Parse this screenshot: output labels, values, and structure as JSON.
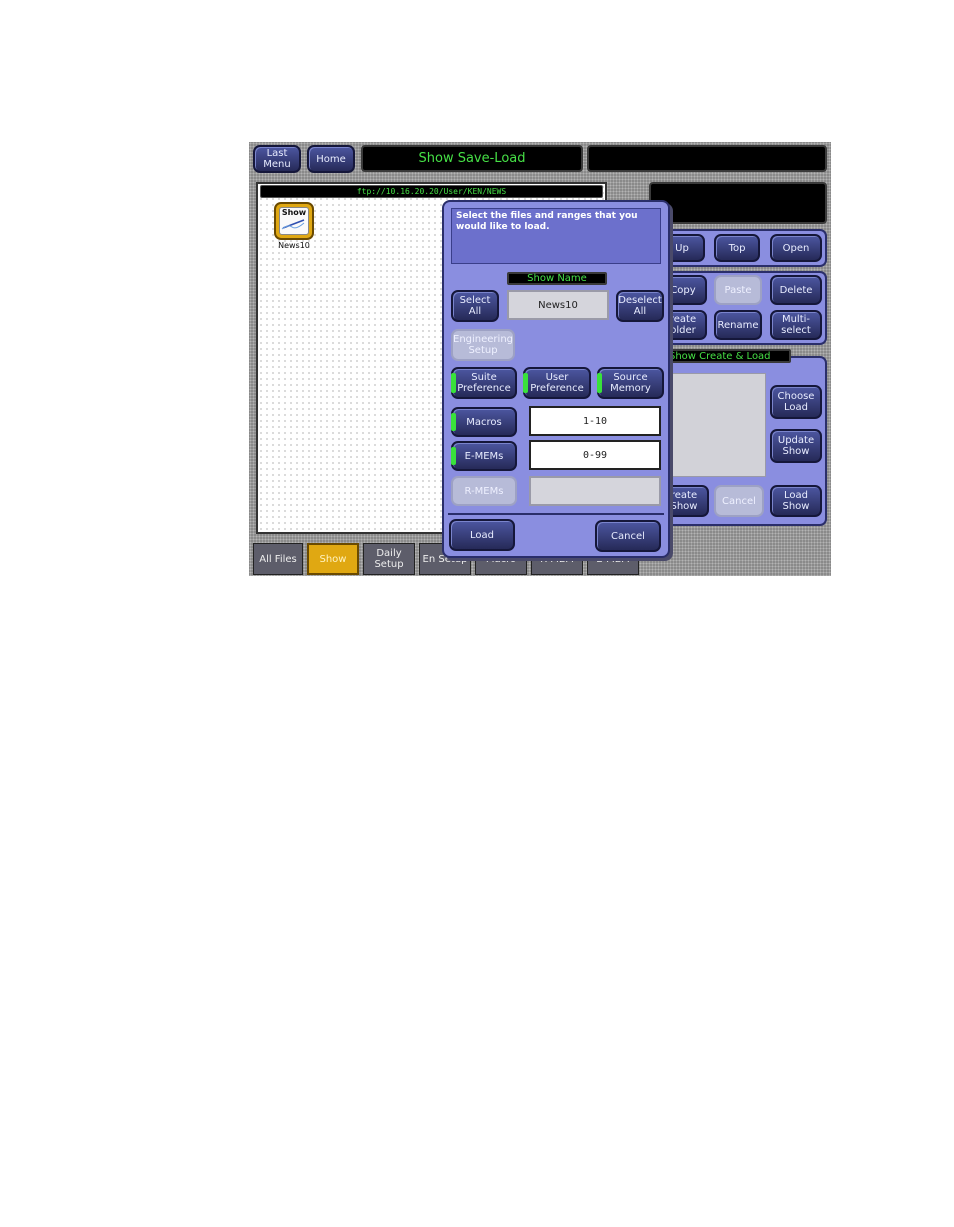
{
  "header": {
    "last_menu": "Last Menu",
    "home": "Home",
    "title": "Show Save-Load"
  },
  "browser": {
    "path": "ftp://10.16.20.20/User/KEN/NEWS",
    "file_icon_label": "Show",
    "file_name": "News10"
  },
  "nav_buttons": [
    "Up",
    "Top",
    "Open"
  ],
  "edit_buttons": [
    "Copy",
    "Paste",
    "Delete",
    "reate older",
    "Rename",
    "Multi-select"
  ],
  "show_panel": {
    "title": "Show Create & Load",
    "choose_load": "Choose Load",
    "update_show": "Update Show",
    "create_show": "reate Show",
    "cancel": "Cancel",
    "load_show": "Load Show"
  },
  "tabs": [
    "All Files",
    "Show",
    "Daily Setup",
    "En Setup",
    "Macro",
    "R-MEM",
    "E-MEM"
  ],
  "dialog": {
    "message": "Select the files and ranges that you would like to load.",
    "show_name_label": "Show Name",
    "show_name_value": "News10",
    "select_all": "Select All",
    "deselect_all": "Deselect All",
    "engineering_setup": "Engineering Setup",
    "suite_preference": "Suite Preference",
    "user_preference": "User Preference",
    "source_memory": "Source Memory",
    "macros": "Macros",
    "macros_range": "1-10",
    "emems": "E-MEMs",
    "emems_range": "0-99",
    "rmems": "R-MEMs",
    "rmems_range": "",
    "load": "Load",
    "cancel": "Cancel"
  },
  "colors": {
    "accent_green": "#39e23b",
    "panel_blue": "#8a8ee0",
    "active_tab": "#e0a812"
  }
}
